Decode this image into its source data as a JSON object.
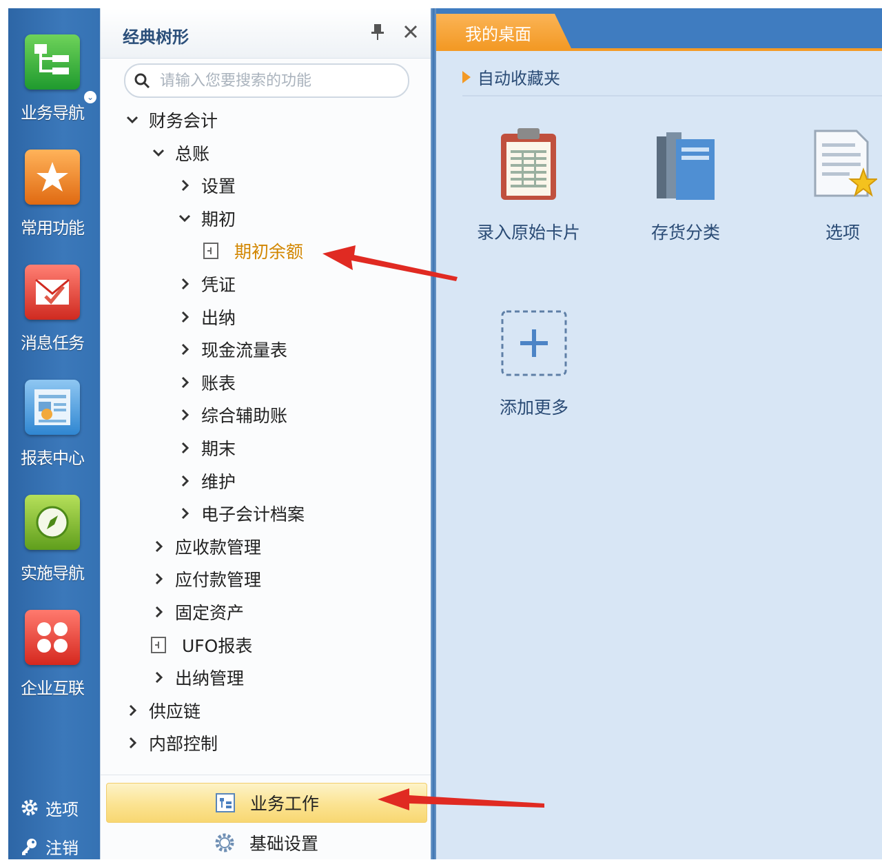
{
  "leftnav": {
    "items": [
      {
        "label": "业务导航",
        "icon": "business-nav-icon"
      },
      {
        "label": "常用功能",
        "icon": "star-icon"
      },
      {
        "label": "消息任务",
        "icon": "message-task-icon"
      },
      {
        "label": "报表中心",
        "icon": "report-center-icon"
      },
      {
        "label": "实施导航",
        "icon": "compass-icon"
      },
      {
        "label": "企业互联",
        "icon": "enterprise-connect-icon"
      }
    ],
    "options_label": "选项",
    "logout_label": "注销"
  },
  "tree": {
    "title": "经典树形",
    "search_placeholder": "请输入您要搜索的功能",
    "rows": [
      {
        "label": "财务会计",
        "state": "expanded"
      },
      {
        "label": "总账",
        "state": "expanded"
      },
      {
        "label": "设置",
        "state": "collapsed"
      },
      {
        "label": "期初",
        "state": "expanded"
      },
      {
        "label": "期初余额",
        "state": "leaf-active"
      },
      {
        "label": "凭证",
        "state": "collapsed"
      },
      {
        "label": "出纳",
        "state": "collapsed"
      },
      {
        "label": "现金流量表",
        "state": "collapsed"
      },
      {
        "label": "账表",
        "state": "collapsed"
      },
      {
        "label": "综合辅助账",
        "state": "collapsed"
      },
      {
        "label": "期末",
        "state": "collapsed"
      },
      {
        "label": "维护",
        "state": "collapsed"
      },
      {
        "label": "电子会计档案",
        "state": "collapsed"
      },
      {
        "label": "应收款管理",
        "state": "collapsed"
      },
      {
        "label": "应付款管理",
        "state": "collapsed"
      },
      {
        "label": "固定资产",
        "state": "collapsed"
      },
      {
        "label": "UFO报表",
        "state": "leaf"
      },
      {
        "label": "出纳管理",
        "state": "collapsed"
      },
      {
        "label": "供应链",
        "state": "collapsed"
      },
      {
        "label": "内部控制",
        "state": "collapsed"
      }
    ],
    "business_work_label": "业务工作",
    "basic_settings_label": "基础设置"
  },
  "main": {
    "tab_label": "我的桌面",
    "section_title": "自动收藏夹",
    "tiles": [
      {
        "label": "录入原始卡片",
        "icon": "clipboard-icon"
      },
      {
        "label": "存货分类",
        "icon": "books-icon"
      },
      {
        "label": "选项",
        "icon": "document-star-icon"
      },
      {
        "label": "添加更多",
        "icon": "add-more-icon"
      }
    ]
  },
  "colors": {
    "nav_blue": "#3572b3",
    "accent_orange": "#f39a26",
    "active_text": "#d28600",
    "main_bg": "#d8e6f5",
    "arrow_red": "#e02a22"
  }
}
